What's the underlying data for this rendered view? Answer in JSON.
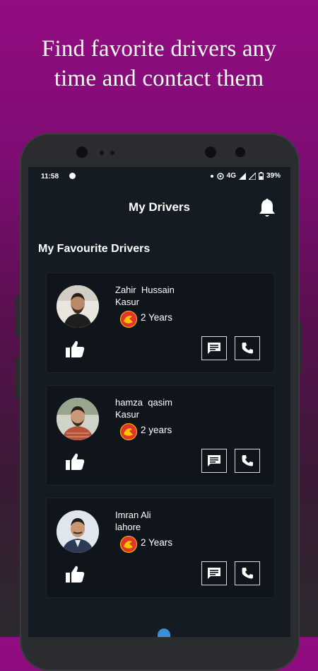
{
  "headline": {
    "line1": "Find favorite drivers any",
    "line2": "time and contact them"
  },
  "status_bar": {
    "time": "11:58",
    "network": "4G",
    "battery": "39%"
  },
  "app_bar": {
    "title": "My Drivers",
    "notification_icon": "bell-icon"
  },
  "section_title": "My Favourite Drivers",
  "drivers": [
    {
      "name": "Zahir  Hussain",
      "city": "Kasur",
      "experience": "2 Years"
    },
    {
      "name": "hamza  qasim",
      "city": "Kasur",
      "experience": "2 years"
    },
    {
      "name": "Imran Ali",
      "city": "lahore",
      "experience": "2 Years"
    }
  ],
  "icons": {
    "like": "thumbs-up-icon",
    "message": "message-icon",
    "call": "phone-icon"
  },
  "colors": {
    "background_top": "#930c82",
    "screen_bg": "#151b22",
    "card_bg": "#0f151b",
    "text": "#ffffff",
    "badge_red": "#e3342c",
    "badge_yellow": "#f7c600"
  }
}
